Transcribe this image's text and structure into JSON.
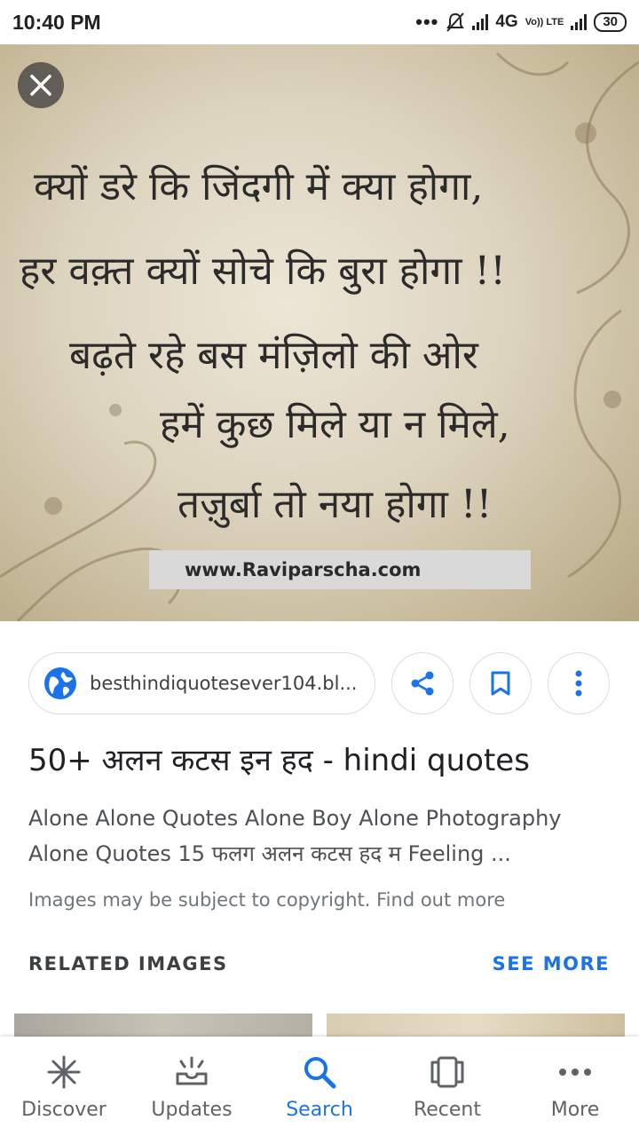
{
  "status_bar": {
    "time": "10:40 PM",
    "network": "4G",
    "volte": "Vo)) LTE",
    "battery": "30"
  },
  "hero_image": {
    "quote_lines": [
      "क्यों डरे कि जिंदगी में क्या होगा,",
      "हर वक़्त क्यों सोचे कि बुरा होगा !!",
      "बढ़ते रहे बस मंज़िलो की ओर",
      "हमें कुछ मिले या न मिले,",
      "तज़ुर्बा तो नया होगा !!"
    ],
    "watermark": "www.Raviparscha.com"
  },
  "source": {
    "url": "besthindiquotesever104.bl..."
  },
  "result": {
    "title": "50+ अलन कटस इन हद - hindi quotes",
    "description": "Alone Alone Quotes Alone Boy Alone Photography Alone Quotes 15 फलग अलन कटस हद म Feeling ...",
    "copyright": "Images may be subject to copyright. Find out more"
  },
  "related": {
    "label": "RELATED IMAGES",
    "see_more": "SEE MORE"
  },
  "bottom_nav": {
    "items": [
      {
        "label": "Discover",
        "icon": "asterisk-icon"
      },
      {
        "label": "Updates",
        "icon": "updates-icon"
      },
      {
        "label": "Search",
        "icon": "search-icon",
        "active": true
      },
      {
        "label": "Recent",
        "icon": "recent-icon"
      },
      {
        "label": "More",
        "icon": "more-horizontal-icon"
      }
    ]
  },
  "colors": {
    "accent": "#1a73e8",
    "text_primary": "#202124",
    "text_secondary": "#5f6368"
  }
}
